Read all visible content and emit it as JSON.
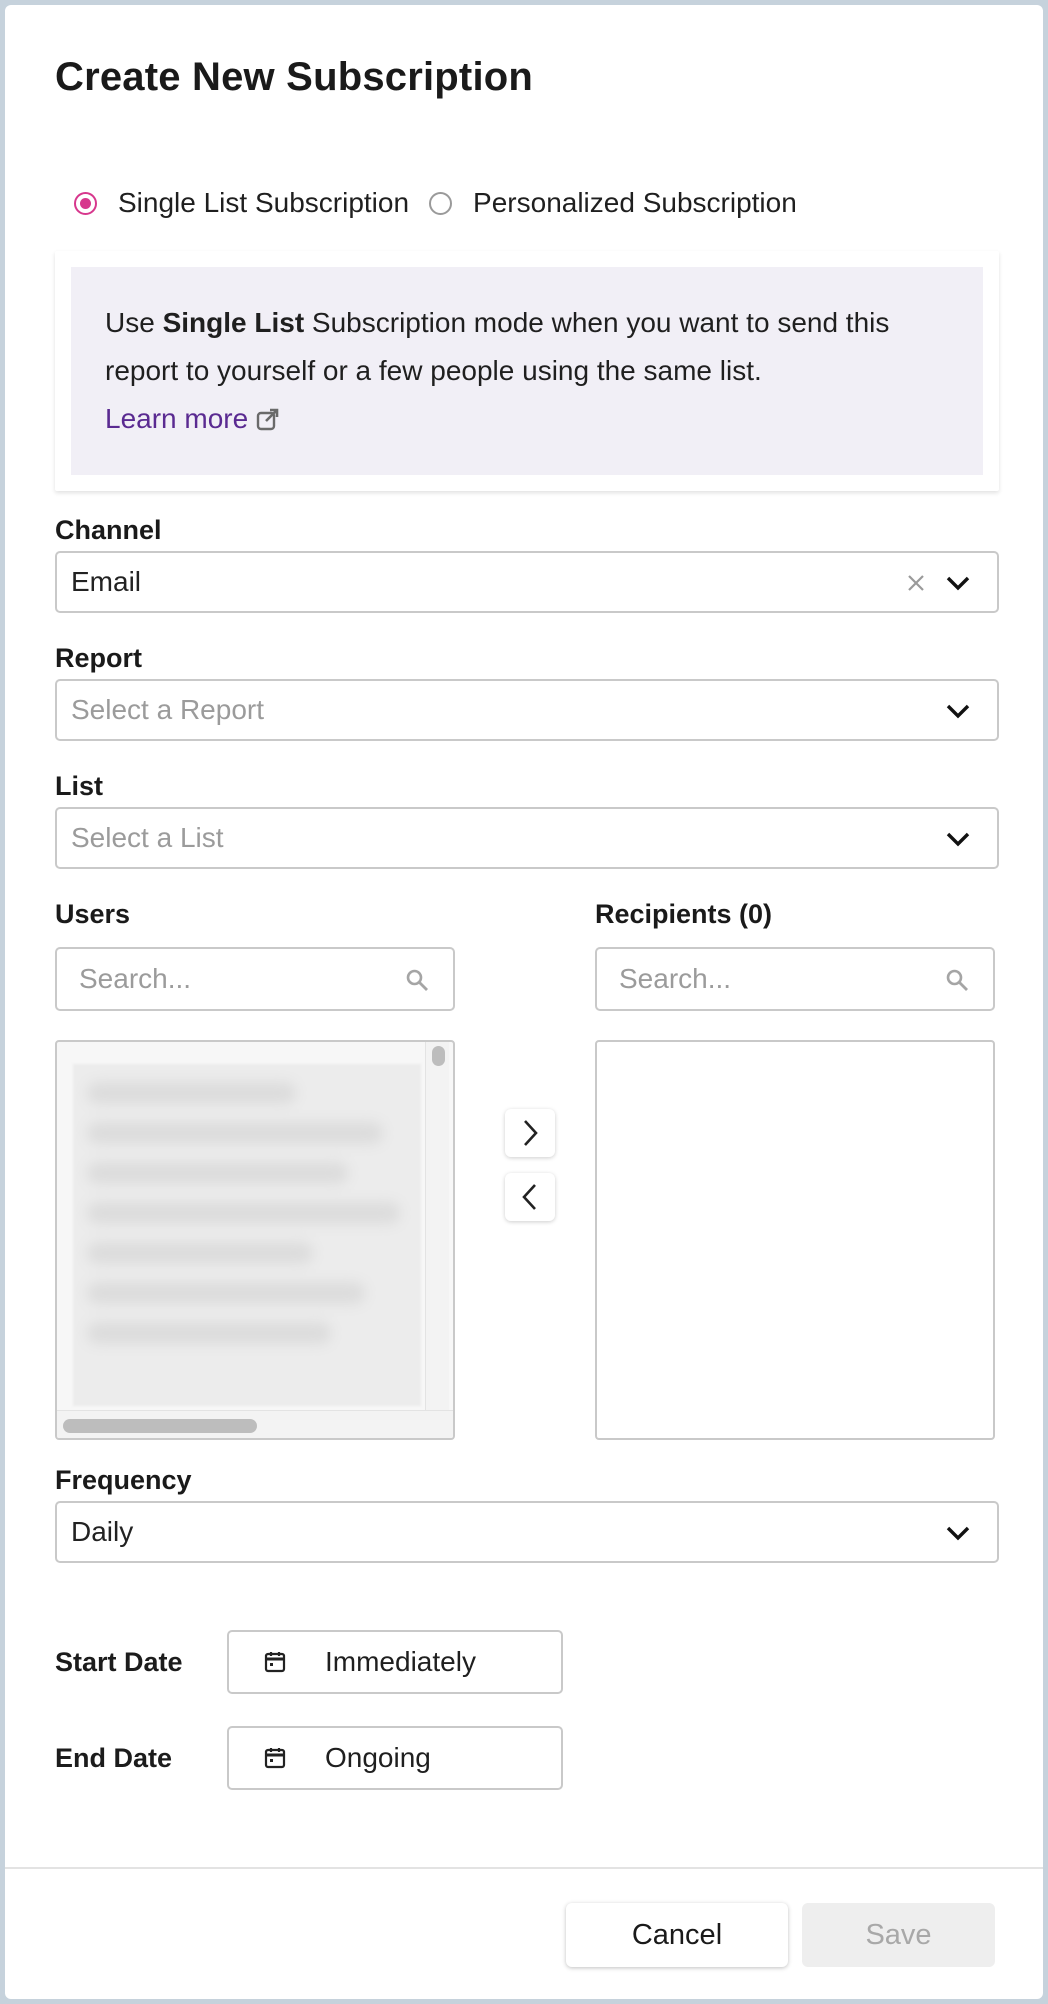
{
  "dialog": {
    "title": "Create New Subscription"
  },
  "mode": {
    "options": [
      {
        "label": "Single List Subscription",
        "checked": true
      },
      {
        "label": "Personalized Subscription",
        "checked": false
      }
    ]
  },
  "info": {
    "prefix": "Use ",
    "bold": "Single List",
    "suffix": " Subscription mode when you want to send this report to yourself or a few people using the same list.",
    "link": "Learn more"
  },
  "channel": {
    "label": "Channel",
    "value": "Email"
  },
  "report": {
    "label": "Report",
    "placeholder": "Select a Report"
  },
  "list": {
    "label": "List",
    "placeholder": "Select a List"
  },
  "users": {
    "label": "Users",
    "search_placeholder": "Search..."
  },
  "recipients": {
    "label": "Recipients (0)",
    "search_placeholder": "Search..."
  },
  "frequency": {
    "label": "Frequency",
    "value": "Daily"
  },
  "start_date": {
    "label": "Start Date",
    "value": "Immediately"
  },
  "end_date": {
    "label": "End Date",
    "value": "Ongoing"
  },
  "footer": {
    "cancel": "Cancel",
    "save": "Save"
  },
  "colors": {
    "accent": "#d7378d",
    "link": "#5a2a91",
    "info_bg": "#f1eff6"
  }
}
